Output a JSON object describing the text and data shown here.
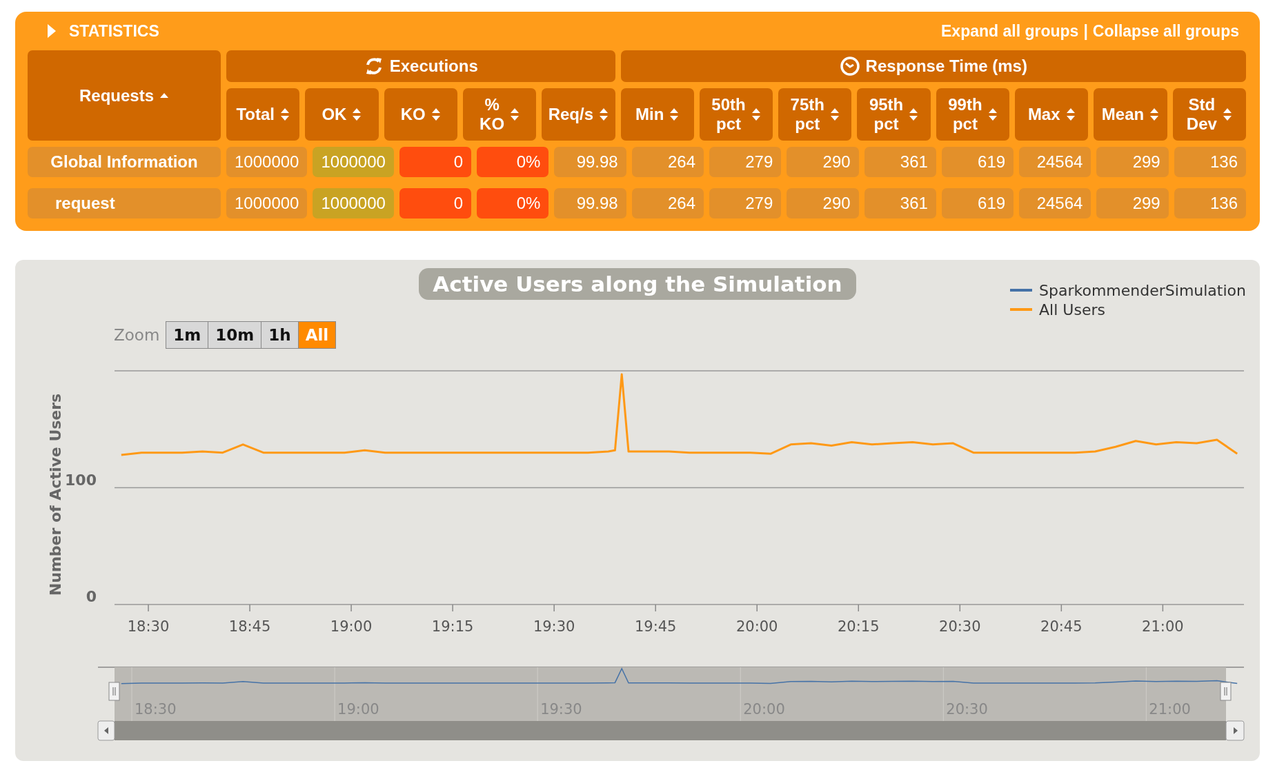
{
  "statistics": {
    "title": "STATISTICS",
    "expanded": false,
    "links": [
      "Expand all groups",
      "Collapse all groups"
    ],
    "separator": "|",
    "request_header": {
      "label": "Requests",
      "sorted": true
    },
    "groups": [
      {
        "label": "Executions",
        "columns": [
          {
            "label": "Total",
            "kind": "plain",
            "sorted": false
          },
          {
            "label": "OK",
            "kind": "ok",
            "sorted": false
          },
          {
            "label": "KO",
            "kind": "ko",
            "sorted": false
          },
          {
            "label": "% KO",
            "kind": "ko",
            "sorted": false
          },
          {
            "label": "Req/s",
            "kind": "plain",
            "sorted": false
          }
        ]
      },
      {
        "label": "Response Time (ms)",
        "columns": [
          {
            "label": "Min",
            "kind": "plain",
            "sorted": false
          },
          {
            "label": "50th pct",
            "kind": "plain",
            "sorted": false
          },
          {
            "label": "75th pct",
            "kind": "plain",
            "sorted": false
          },
          {
            "label": "95th pct",
            "kind": "plain",
            "sorted": false
          },
          {
            "label": "99th pct",
            "kind": "plain",
            "sorted": false
          },
          {
            "label": "Max",
            "kind": "plain",
            "sorted": false
          },
          {
            "label": "Mean",
            "kind": "plain",
            "sorted": false
          },
          {
            "label": "Std Dev",
            "kind": "plain",
            "sorted": false
          }
        ]
      }
    ],
    "rows": [
      {
        "kind": "total",
        "name": "Global Information",
        "cells": [
          "1000000",
          "1000000",
          "0",
          "0%",
          "99.98",
          "264",
          "279",
          "290",
          "361",
          "619",
          "24564",
          "299",
          "136"
        ]
      },
      {
        "kind": "request",
        "name": "request",
        "cells": [
          "1000000",
          "1000000",
          "0",
          "0%",
          "99.98",
          "264",
          "279",
          "290",
          "361",
          "619",
          "24564",
          "299",
          "136"
        ]
      }
    ]
  },
  "active_users": {
    "title": "Active Users along the Simulation",
    "legend": [
      {
        "name": "SparkommenderSimulation",
        "color": "#4572a7"
      }
    ],
    "zoom": {
      "label": "Zoom",
      "buttons": [
        {
          "label": "1m",
          "selected": false
        },
        {
          "label": "10m",
          "selected": false
        },
        {
          "label": "1h",
          "selected": false
        },
        {
          "label": "All",
          "selected": true
        }
      ]
    },
    "chart_data": {
      "type": "line",
      "ylabel": "Number of Active Users",
      "x": [
        1106,
        1109,
        1112,
        1115,
        1118,
        1121,
        1124,
        1127,
        1130,
        1133,
        1136,
        1139,
        1142,
        1145,
        1148,
        1151,
        1154,
        1157,
        1160,
        1163,
        1166,
        1169,
        1172,
        1175,
        1178,
        1179,
        1180,
        1181,
        1184,
        1187,
        1190,
        1193,
        1196,
        1199,
        1202,
        1205,
        1208,
        1211,
        1214,
        1217,
        1220,
        1223,
        1226,
        1229,
        1232,
        1235,
        1238,
        1241,
        1244,
        1247,
        1250,
        1253,
        1256,
        1259,
        1262,
        1265,
        1268,
        1271
      ],
      "series": [
        {
          "name": "All Users",
          "color": "#ff9916",
          "values": [
            128,
            130,
            130,
            130,
            131,
            130,
            137,
            130,
            130,
            130,
            130,
            130,
            132,
            130,
            130,
            130,
            130,
            130,
            130,
            130,
            130,
            130,
            130,
            130,
            131,
            132,
            197,
            131,
            131,
            131,
            130,
            130,
            130,
            130,
            129,
            137,
            138,
            136,
            139,
            137,
            138,
            139,
            137,
            138,
            130,
            130,
            130,
            130,
            130,
            130,
            131,
            135,
            140,
            137,
            139,
            138,
            141,
            129
          ]
        }
      ],
      "xlim": [
        1105,
        1272
      ],
      "ylim": [
        0,
        200
      ],
      "yticks": [
        0,
        100
      ],
      "xticks": [
        {
          "value": 1110,
          "label": "18:30"
        },
        {
          "value": 1125,
          "label": "18:45"
        },
        {
          "value": 1140,
          "label": "19:00"
        },
        {
          "value": 1155,
          "label": "19:15"
        },
        {
          "value": 1170,
          "label": "19:30"
        },
        {
          "value": 1185,
          "label": "19:45"
        },
        {
          "value": 1200,
          "label": "20:00"
        },
        {
          "value": 1215,
          "label": "20:15"
        },
        {
          "value": 1230,
          "label": "20:30"
        },
        {
          "value": 1245,
          "label": "20:45"
        },
        {
          "value": 1260,
          "label": "21:00"
        }
      ]
    },
    "navigator": {
      "labels": [
        "18:30",
        "19:00",
        "19:30",
        "20:00",
        "20:30",
        "21:00"
      ]
    }
  }
}
